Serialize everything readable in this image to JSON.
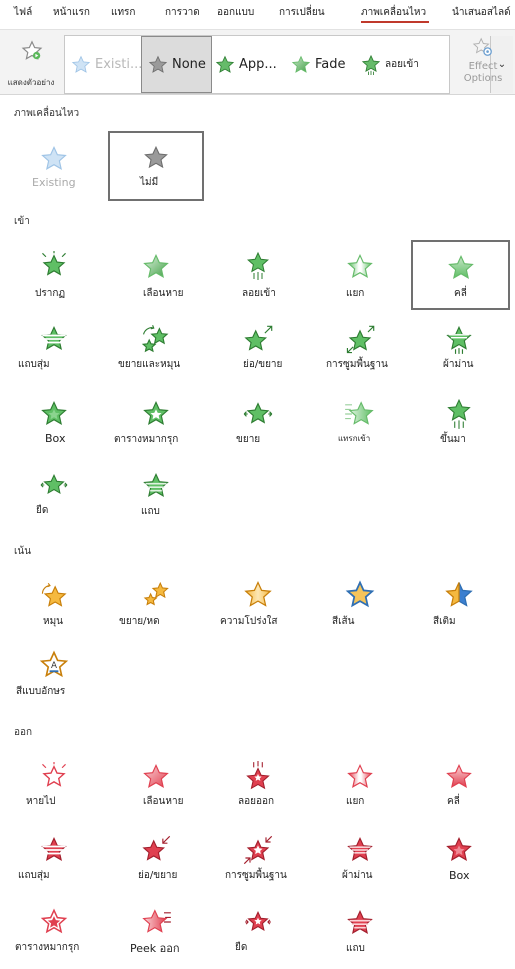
{
  "tabs": [
    {
      "label": "ไฟล์"
    },
    {
      "label": "หน้าแรก"
    },
    {
      "label": "แทรก"
    },
    {
      "label": "การวาด"
    },
    {
      "label": "ออกแบบ"
    },
    {
      "label": "การเปลี่ยน"
    },
    {
      "label": "ภาพเคลื่อนไหว",
      "active": true
    },
    {
      "label": "นำเสนอสไลด์"
    }
  ],
  "ribbon": {
    "preview_label": "แสดงตัวอย่าง",
    "gallery": [
      {
        "label": "Existi...",
        "icon": "existing-star-icon"
      },
      {
        "label": "None",
        "icon": "none-star-icon",
        "selected": true
      },
      {
        "label": "App...",
        "icon": "appear-star-icon"
      },
      {
        "label": "Fade",
        "icon": "fade-star-icon"
      },
      {
        "label": "ลอยเข้า",
        "icon": "fly-in-star-icon"
      }
    ],
    "more_button": "⌄",
    "effect_options": "Effect Options"
  },
  "colors": {
    "entrance": "#4caf50",
    "emphasis": "#f0a030",
    "exit": "#e04050",
    "none": "#8a8a8a",
    "accent_tab": "#c0392b"
  },
  "sections": {
    "animation": {
      "title": "ภาพเคลื่อนไหว",
      "items": [
        {
          "label": "Existing",
          "icon": "existing-star-icon"
        },
        {
          "label": "ไม่มี",
          "icon": "none-star-icon",
          "selected": true
        }
      ]
    },
    "entrance": {
      "title": "เข้า",
      "items": [
        {
          "label": "ปรากฏ",
          "icon": "appear-star-icon"
        },
        {
          "label": "เลือนหาย",
          "icon": "fade-star-icon"
        },
        {
          "label": "ลอยเข้า",
          "icon": "fly-in-star-icon"
        },
        {
          "label": "แยก",
          "icon": "split-star-icon"
        },
        {
          "label": "คลี่",
          "icon": "wipe-star-icon",
          "selected": true
        },
        {
          "label": "แถบสุ่ม",
          "icon": "random-bars-star-icon"
        },
        {
          "label": "ขยายและหมุน",
          "icon": "grow-turn-star-icon"
        },
        {
          "label": "ย่อ/ขยาย",
          "icon": "zoom-star-icon"
        },
        {
          "label": "การซูมพื้นฐาน",
          "icon": "basic-zoom-star-icon"
        },
        {
          "label": "ผ้าม่าน",
          "icon": "curtain-star-icon"
        },
        {
          "label": "Box",
          "icon": "box-star-icon"
        },
        {
          "label": "ตารางหมากรุก",
          "icon": "checkerboard-star-icon"
        },
        {
          "label": "ขยาย",
          "icon": "expand-star-icon"
        },
        {
          "label": "แทรกเข้า",
          "icon": "peek-in-star-icon"
        },
        {
          "label": "ขึ้นมา",
          "icon": "rise-up-star-icon"
        },
        {
          "label": "ยืด",
          "icon": "stretch-star-icon"
        },
        {
          "label": "แถบ",
          "icon": "strips-star-icon"
        }
      ]
    },
    "emphasis": {
      "title": "เน้น",
      "items": [
        {
          "label": "หมุน",
          "icon": "spin-star-icon"
        },
        {
          "label": "ขยาย/หด",
          "icon": "grow-shrink-star-icon"
        },
        {
          "label": "ความโปร่งใส",
          "icon": "transparency-star-icon"
        },
        {
          "label": "สีเส้น",
          "icon": "line-color-star-icon"
        },
        {
          "label": "สีเติม",
          "icon": "fill-color-star-icon"
        },
        {
          "label": "สีแบบอักษร",
          "icon": "font-color-star-icon"
        }
      ]
    },
    "exit": {
      "title": "ออก",
      "items": [
        {
          "label": "หายไป",
          "icon": "disappear-star-icon"
        },
        {
          "label": "เลือนหาย",
          "icon": "fade-out-star-icon"
        },
        {
          "label": "ลอยออก",
          "icon": "fly-out-star-icon"
        },
        {
          "label": "แยก",
          "icon": "split-out-star-icon"
        },
        {
          "label": "คลี่",
          "icon": "wipe-out-star-icon"
        },
        {
          "label": "แถบสุ่ม",
          "icon": "random-bars-out-star-icon"
        },
        {
          "label": "ย่อ/ขยาย",
          "icon": "zoom-out-star-icon"
        },
        {
          "label": "การซูมพื้นฐาน",
          "icon": "basic-zoom-out-star-icon"
        },
        {
          "label": "ผ้าม่าน",
          "icon": "curtain-out-star-icon"
        },
        {
          "label": "Box",
          "icon": "box-out-star-icon"
        },
        {
          "label": "ตารางหมากรุก",
          "icon": "checkerboard-out-star-icon"
        },
        {
          "label": "Peek ออก",
          "icon": "peek-out-star-icon"
        },
        {
          "label": "ยืด",
          "icon": "stretch-out-star-icon"
        },
        {
          "label": "แถบ",
          "icon": "strips-out-star-icon"
        }
      ]
    }
  }
}
